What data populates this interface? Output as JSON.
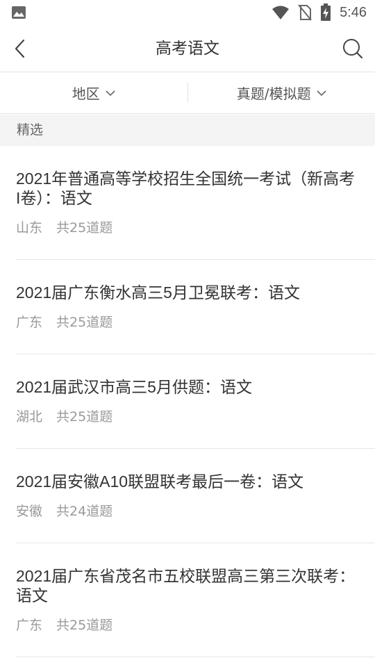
{
  "status_bar": {
    "time": "5:46",
    "icons": [
      "image-icon",
      "wifi-icon",
      "no-sim-icon",
      "battery-charging-icon"
    ]
  },
  "app_bar": {
    "title": "高考语文",
    "back_icon": "chevron-left-icon",
    "search_icon": "search-icon"
  },
  "filters": {
    "region_label": "地区",
    "type_label": "真题/模拟题"
  },
  "section": {
    "title": "精选"
  },
  "items": [
    {
      "title": "2021年普通高等学校招生全国统一考试（新高考I卷）：语文",
      "region": "山东",
      "count": "共25道题"
    },
    {
      "title": "2021届广东衡水高三5月卫冕联考：语文",
      "region": "广东",
      "count": "共25道题"
    },
    {
      "title": "2021届武汉市高三5月供题：语文",
      "region": "湖北",
      "count": "共25道题"
    },
    {
      "title": "2021届安徽A10联盟联考最后一卷：语文",
      "region": "安徽",
      "count": "共24道题"
    },
    {
      "title": "2021届广东省茂名市五校联盟高三第三次联考：语文",
      "region": "广东",
      "count": "共25道题"
    }
  ]
}
